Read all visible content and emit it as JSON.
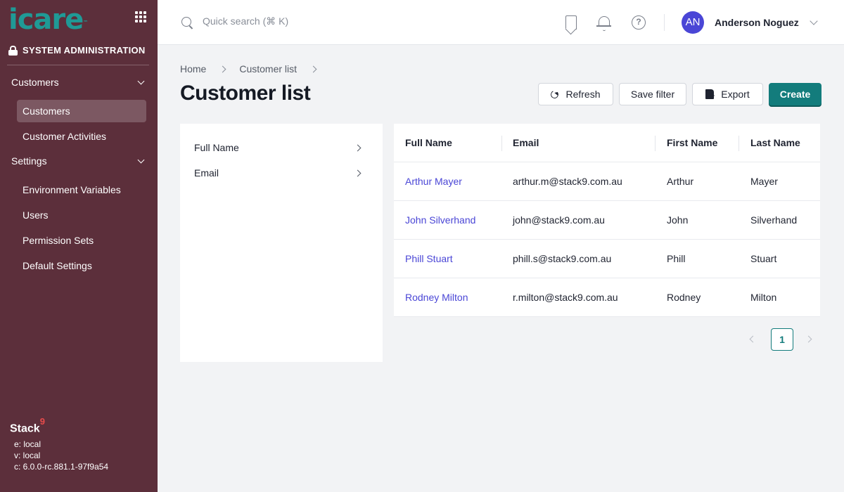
{
  "sidebar": {
    "logo_text": "icare",
    "logo_mark": "™",
    "section_title": "SYSTEM ADMINISTRATION",
    "groups": [
      {
        "label": "Customers",
        "items": [
          {
            "label": "Customers",
            "active": true
          },
          {
            "label": "Customer Activities"
          }
        ]
      },
      {
        "label": "Settings",
        "items": [
          {
            "label": "Environment Variables"
          },
          {
            "label": "Users"
          },
          {
            "label": "Permission Sets"
          },
          {
            "label": "Default Settings"
          }
        ]
      }
    ],
    "footer": {
      "brand": "Stack",
      "brand_sup": "9",
      "env": "e: local",
      "version": "v: local",
      "commit": "c: 6.0.0-rc.881.1-97f9a54"
    }
  },
  "topbar": {
    "search_placeholder": "Quick search (⌘ K)",
    "user_initials": "AN",
    "user_name": "Anderson Noguez"
  },
  "breadcrumb": [
    "Home",
    "Customer list"
  ],
  "page_title": "Customer list",
  "toolbar": {
    "refresh_label": "Refresh",
    "save_filter_label": "Save filter",
    "export_label": "Export",
    "create_label": "Create"
  },
  "filters": [
    "Full Name",
    "Email"
  ],
  "table": {
    "columns": [
      "Full Name",
      "Email",
      "First Name",
      "Last Name"
    ],
    "rows": [
      [
        "Arthur Mayer",
        "arthur.m@stack9.com.au",
        "Arthur",
        "Mayer"
      ],
      [
        "John Silverhand",
        "john@stack9.com.au",
        "John",
        "Silverhand"
      ],
      [
        "Phill Stuart",
        "phill.s@stack9.com.au",
        "Phill",
        "Stuart"
      ],
      [
        "Rodney Milton",
        "r.milton@stack9.com.au",
        "Rodney",
        "Milton"
      ]
    ]
  },
  "pagination": {
    "current_page": "1"
  },
  "colors": {
    "sidebar": "#5c2f3b",
    "accent": "#137c7c",
    "link": "#4a46d6",
    "logo": "#1f9a96"
  }
}
